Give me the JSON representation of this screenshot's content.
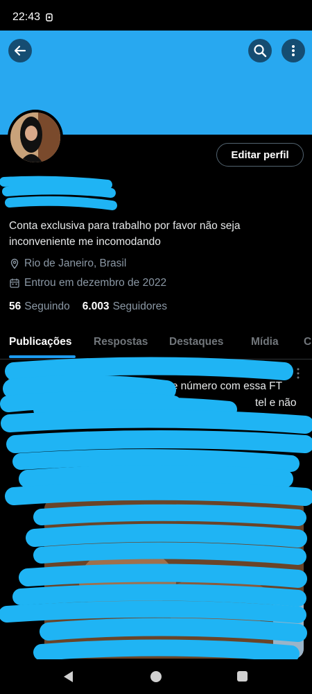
{
  "status_bar": {
    "time": "22:43"
  },
  "profile": {
    "edit_button": "Editar perfil",
    "bio": "Conta exclusiva para trabalho por favor não seja inconveniente me incomodando",
    "location": "Rio de Janeiro, Brasil",
    "joined": "Entrou em dezembro de 2022",
    "following_count": "56",
    "following_label": "Seguindo",
    "followers_count": "6.003",
    "followers_label": "Seguidores"
  },
  "tabs": [
    {
      "label": "Publicações",
      "active": true
    },
    {
      "label": "Respostas",
      "active": false
    },
    {
      "label": "Destaques",
      "active": false
    },
    {
      "label": "Mídia",
      "active": false
    },
    {
      "label": "C",
      "active": false
    }
  ],
  "post": {
    "text_line_1": "se número com essa FT",
    "text_line_2": "tel e não"
  },
  "colors": {
    "banner": "#28a8f0",
    "accent": "#1d9bf0",
    "redaction": "#1fb4f4",
    "background": "#000000"
  },
  "icons": [
    "back-arrow-icon",
    "search-icon",
    "more-vertical-icon",
    "location-pin-icon",
    "calendar-icon",
    "nav-back-icon",
    "nav-home-icon",
    "nav-recents-icon"
  ]
}
